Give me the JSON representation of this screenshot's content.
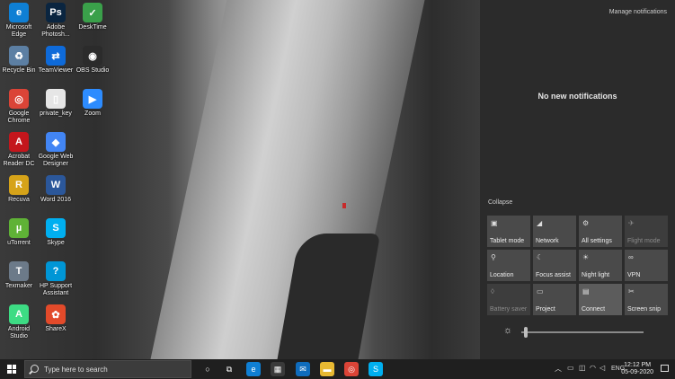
{
  "desktop": {
    "icons": [
      {
        "label": "Microsoft Edge",
        "glyph": "e",
        "color": "#0f7fd4",
        "col": 0,
        "row": 0
      },
      {
        "label": "Adobe Photosh...",
        "glyph": "Ps",
        "color": "#0a2540",
        "col": 1,
        "row": 0
      },
      {
        "label": "DeskTime",
        "glyph": "✓",
        "color": "#3aa04a",
        "col": 2,
        "row": 0
      },
      {
        "label": "Recycle Bin",
        "glyph": "♻",
        "color": "#5c7fa3",
        "col": 0,
        "row": 1
      },
      {
        "label": "TeamViewer",
        "glyph": "⇄",
        "color": "#0e6ad9",
        "col": 1,
        "row": 1
      },
      {
        "label": "OBS Studio",
        "glyph": "◉",
        "color": "#2b2b2b",
        "col": 2,
        "row": 1
      },
      {
        "label": "Google Chrome",
        "glyph": "◎",
        "color": "#db4437",
        "col": 0,
        "row": 2
      },
      {
        "label": "private_key",
        "glyph": "▯",
        "color": "#e6e6e6",
        "col": 1,
        "row": 2
      },
      {
        "label": "Zoom",
        "glyph": "▶",
        "color": "#2d8cff",
        "col": 2,
        "row": 2
      },
      {
        "label": "Acrobat Reader DC",
        "glyph": "A",
        "color": "#c4161c",
        "col": 0,
        "row": 3
      },
      {
        "label": "Google Web Designer",
        "glyph": "◆",
        "color": "#4285f4",
        "col": 1,
        "row": 3
      },
      {
        "label": "Recuva",
        "glyph": "R",
        "color": "#d6a319",
        "col": 0,
        "row": 4
      },
      {
        "label": "Word 2016",
        "glyph": "W",
        "color": "#2b579a",
        "col": 1,
        "row": 4
      },
      {
        "label": "uTorrent",
        "glyph": "µ",
        "color": "#5fb236",
        "col": 0,
        "row": 5
      },
      {
        "label": "Skype",
        "glyph": "S",
        "color": "#00aff0",
        "col": 1,
        "row": 5
      },
      {
        "label": "Texmaker",
        "glyph": "T",
        "color": "#6c7a89",
        "col": 0,
        "row": 6
      },
      {
        "label": "HP Support Assistant",
        "glyph": "?",
        "color": "#0096d6",
        "col": 1,
        "row": 6
      },
      {
        "label": "Android Studio",
        "glyph": "A",
        "color": "#3ddc84",
        "col": 0,
        "row": 7
      },
      {
        "label": "ShareX",
        "glyph": "✿",
        "color": "#e24a2a",
        "col": 1,
        "row": 7
      }
    ]
  },
  "action_center": {
    "manage_label": "Manage notifications",
    "empty_label": "No new notifications",
    "collapse_label": "Collapse",
    "quick_actions": [
      {
        "label": "Tablet mode",
        "icon": "tablet-mode-icon",
        "glyph": "▣",
        "state": "normal"
      },
      {
        "label": "Network",
        "icon": "network-icon",
        "glyph": "◢",
        "state": "normal"
      },
      {
        "label": "All settings",
        "icon": "gear-icon",
        "glyph": "⚙",
        "state": "normal"
      },
      {
        "label": "Flight mode",
        "icon": "airplane-icon",
        "glyph": "✈",
        "state": "dim"
      },
      {
        "label": "Location",
        "icon": "location-icon",
        "glyph": "⚲",
        "state": "normal"
      },
      {
        "label": "Focus assist",
        "icon": "moon-icon",
        "glyph": "☾",
        "state": "normal"
      },
      {
        "label": "Night light",
        "icon": "night-light-icon",
        "glyph": "☀",
        "state": "normal"
      },
      {
        "label": "VPN",
        "icon": "vpn-icon",
        "glyph": "∞",
        "state": "normal"
      },
      {
        "label": "Battery saver",
        "icon": "battery-saver-icon",
        "glyph": "◊",
        "state": "dim"
      },
      {
        "label": "Project",
        "icon": "project-icon",
        "glyph": "▭",
        "state": "normal"
      },
      {
        "label": "Connect",
        "icon": "connect-icon",
        "glyph": "▤",
        "state": "active"
      },
      {
        "label": "Screen snip",
        "icon": "screen-snip-icon",
        "glyph": "✂",
        "state": "normal"
      }
    ],
    "brightness_level": 0.02
  },
  "taskbar": {
    "search_placeholder": "Type here to search",
    "pinned": [
      {
        "name": "cortana-icon",
        "glyph": "○",
        "color": "transparent"
      },
      {
        "name": "task-view-icon",
        "glyph": "⧉",
        "color": "transparent"
      },
      {
        "name": "edge-icon",
        "glyph": "e",
        "color": "#0f7fd4"
      },
      {
        "name": "store-icon",
        "glyph": "▦",
        "color": "#3a3a3a"
      },
      {
        "name": "mail-icon",
        "glyph": "✉",
        "color": "#0f6cbd"
      },
      {
        "name": "file-explorer-icon",
        "glyph": "▬",
        "color": "#e8b932"
      },
      {
        "name": "chrome-icon",
        "glyph": "◎",
        "color": "#db4437"
      },
      {
        "name": "skype-icon",
        "glyph": "S",
        "color": "#00aff0"
      }
    ],
    "language": "ENG",
    "time": "12:12 PM",
    "date": "05-09-2020"
  }
}
